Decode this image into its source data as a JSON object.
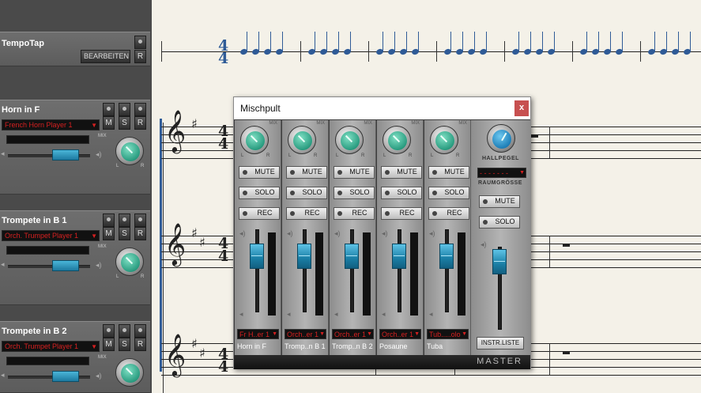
{
  "tracks": {
    "tempo": {
      "name": "TempoTap",
      "edit_label": "BEARBEITEN",
      "r_label": "R"
    },
    "items": [
      {
        "name": "Horn in F",
        "player": "French Horn Player 1",
        "mix_label": "MIX",
        "l": "L",
        "r": "R"
      },
      {
        "name": "Trompete in B 1",
        "player": "Orch. Trumpet Player 1",
        "mix_label": "MIX",
        "l": "L",
        "r": "R"
      },
      {
        "name": "Trompete in B 2",
        "player": "Orch. Trumpet Player 1",
        "mix_label": "MIX",
        "l": "L",
        "r": "R"
      }
    ],
    "m_label": "M",
    "s_label": "S",
    "r_label": "R",
    "select_arrow": "▼",
    "speaker_icon": "◂)"
  },
  "score": {
    "time_top": "4",
    "time_bottom": "4",
    "clef": "𝄞",
    "sharp": "♯"
  },
  "mixer": {
    "title": "Mischpult",
    "close": "x",
    "mute": "MUTE",
    "solo": "SOLO",
    "rec": "REC",
    "mix": "MIX",
    "l": "L",
    "r": "R",
    "strips": [
      {
        "select": "Fr H..er 1",
        "name": "Horn in F"
      },
      {
        "select": "Orch..er 1",
        "name": "Tromp..n B 1"
      },
      {
        "select": "Orch..er 1",
        "name": "Tromp..n B 2"
      },
      {
        "select": "Orch..er 1",
        "name": "Posaune"
      },
      {
        "select": "Tub.....olo",
        "name": "Tuba"
      }
    ],
    "master": {
      "hallpegel": "HALLPEGEL",
      "raumgroesse": "RAUMGRÖSSE",
      "room_select": "- - - - - - -",
      "instr_liste": "INSTR.LISTE",
      "footer": "MASTER"
    }
  }
}
